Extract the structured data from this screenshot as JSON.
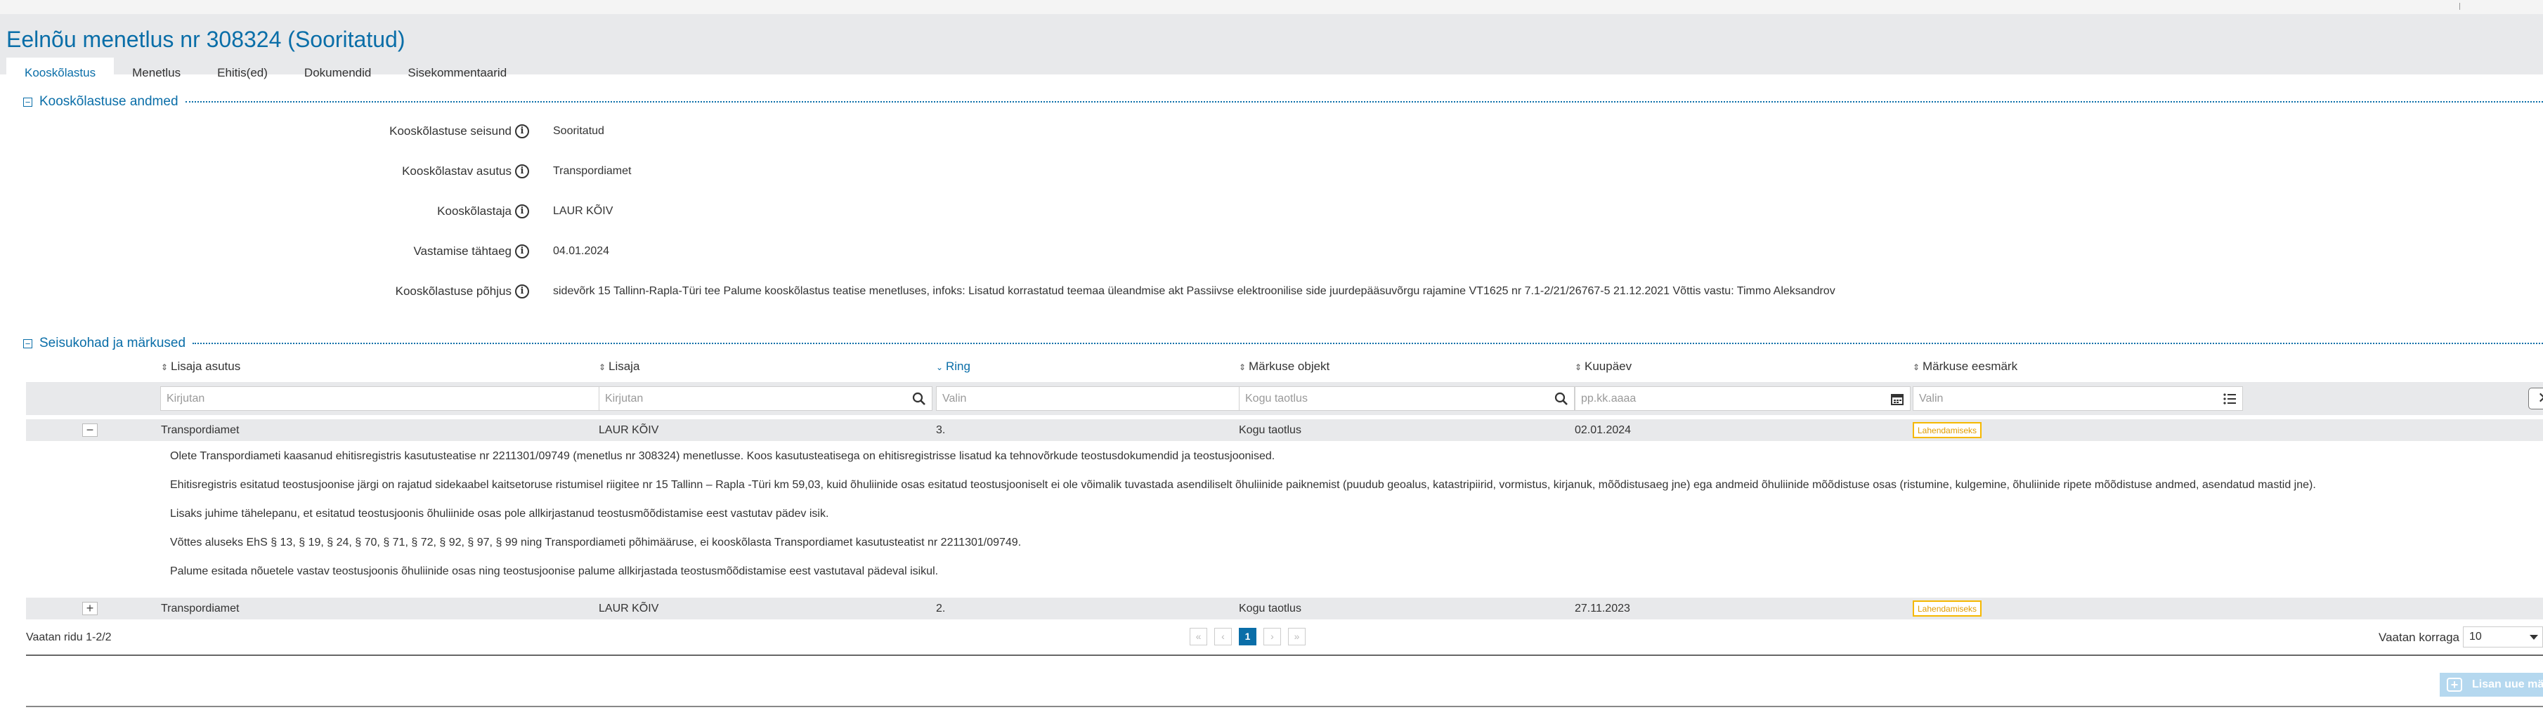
{
  "page_title": "Eelnõu menetlus nr 308324 (Sooritatud)",
  "tabs": [
    {
      "label": "Kooskõlastus",
      "active": true
    },
    {
      "label": "Menetlus"
    },
    {
      "label": "Ehitis(ed)"
    },
    {
      "label": "Dokumendid"
    },
    {
      "label": "Sisekommentaarid"
    }
  ],
  "section1": {
    "title": "Kooskõlastuse andmed",
    "fields": [
      {
        "label": "Kooskõlastuse seisund",
        "value": "Sooritatud"
      },
      {
        "label": "Kooskõlastav asutus",
        "value": "Transpordiamet"
      },
      {
        "label": "Kooskõlastaja",
        "value": "LAUR KÕIV"
      },
      {
        "label": "Vastamise tähtaeg",
        "value": "04.01.2024"
      },
      {
        "label": "Kooskõlastuse põhjus",
        "value": "sidevõrk 15 Tallinn-Rapla-Türi tee Palume kooskõlastus teatise menetluses, infoks: Lisatud korrastatud teemaa üleandmise akt Passiivse elektroonilise side juurdepääsuvõrgu rajamine VT1625 nr 7.1-2/21/26767-5 21.12.2021 Võttis vastu: Timmo Aleksandrov"
      }
    ]
  },
  "section2": {
    "title": "Seisukohad ja märkused",
    "columns": [
      {
        "label": "Lisaja asutus",
        "sort": "both"
      },
      {
        "label": "Lisaja",
        "sort": "both"
      },
      {
        "label": "Ring",
        "sort": "desc"
      },
      {
        "label": "Märkuse objekt",
        "sort": "both"
      },
      {
        "label": "Kuupäev",
        "sort": "both"
      },
      {
        "label": "Märkuse eesmärk",
        "sort": "both"
      }
    ],
    "filters": [
      {
        "placeholder": "Kirjutan",
        "icon": "search-icon"
      },
      {
        "placeholder": "Kirjutan",
        "icon": "search-icon"
      },
      {
        "placeholder": "Valin",
        "icon": "list-icon"
      },
      {
        "placeholder": "Kogu taotlus",
        "icon": "search-icon"
      },
      {
        "placeholder": "pp.kk.aaaa",
        "icon": "calendar-icon"
      },
      {
        "placeholder": "Valin",
        "icon": "list-icon"
      }
    ],
    "clear_label": "✕",
    "rows": [
      {
        "toggle": "−",
        "asutus": "Transpordiamet",
        "lisaja": "LAUR KÕIV",
        "ring": "3.",
        "objekt": "Kogu taotlus",
        "kuupaev": "02.01.2024",
        "eesmark": "Lahendamiseks",
        "remarks": [
          "Olete Transpordiameti kaasanud ehitisregistris kasutusteatise nr 2211301/09749 (menetlus nr 308324) menetlusse. Koos kasutusteatisega on ehitisregistrisse lisatud ka tehnovõrkude teostusdokumendid ja teostusjoonised.",
          "Ehitisregistris esitatud teostusjoonise järgi on rajatud sidekaabel kaitsetoruse ristumisel riigitee nr 15 Tallinn – Rapla -Türi km 59,03, kuid õhuliinide osas esitatud teostusjooniselt ei ole võimalik tuvastada asendiliselt õhuliinide paiknemist (puudub geoalus, katastripiirid, vormistus, kirjanuk, mõõdistusaeg jne) ega andmeid õhuliinide mõõdistuse osas (ristumine, kulgemine, õhuliinide ripete mõõdistuse andmed, asendatud mastid jne).",
          "Lisaks juhime tähelepanu, et esitatud teostusjoonis õhuliinide osas pole allkirjastanud teostusmõõdistamise eest vastutav pädev isik.",
          "Võttes aluseks EhS § 13, § 19, § 24, § 70, § 71, § 72, § 92, § 97, § 99 ning Transpordiameti põhimääruse, ei kooskõlasta Transpordiamet kasutusteatist nr 2211301/09749.",
          "Palume esitada nõuetele vastav teostusjoonis õhuliinide osas ning teostusjoonise palume allkirjastada teostusmõõdistamise eest vastutaval pädeval isikul."
        ]
      },
      {
        "toggle": "+",
        "asutus": "Transpordiamet",
        "lisaja": "LAUR KÕIV",
        "ring": "2.",
        "objekt": "Kogu taotlus",
        "kuupaev": "27.11.2023",
        "eesmark": "Lahendamiseks"
      }
    ],
    "row_count": "Vaatan ridu 1-2/2",
    "pager": {
      "first": "«",
      "prev": "‹",
      "current": "1",
      "next": "›",
      "last": "»"
    },
    "page_size_label": "Vaatan korraga",
    "page_size": "10",
    "add_button": "Lisan uue märkuse"
  },
  "colors": {
    "accent": "#0a6ea8",
    "header_bg": "#e8e9eb",
    "badge": "#f5b800"
  }
}
